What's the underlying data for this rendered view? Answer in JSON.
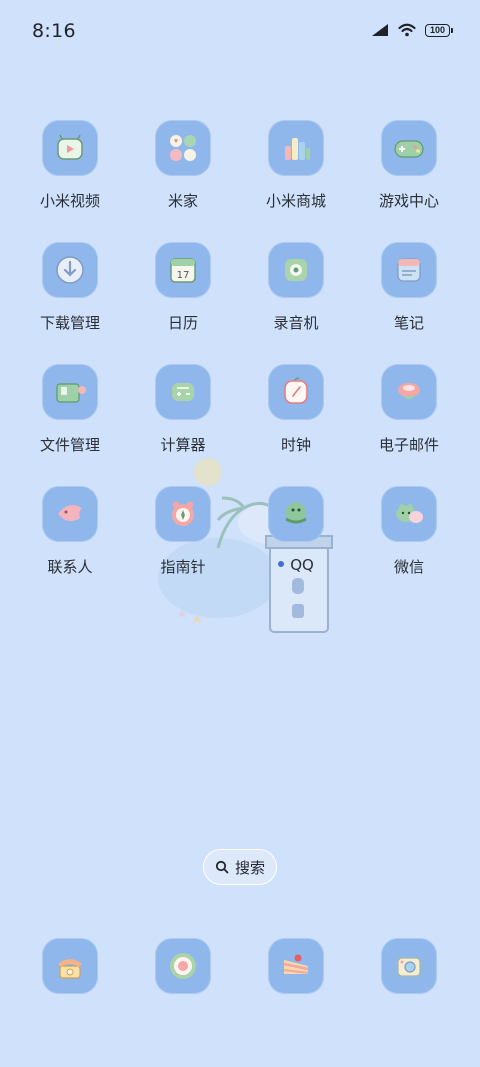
{
  "status_bar": {
    "time": "8:16",
    "battery": "100"
  },
  "apps": [
    {
      "label": "小米视频",
      "icon": "mi-video-icon"
    },
    {
      "label": "米家",
      "icon": "mijia-icon"
    },
    {
      "label": "小米商城",
      "icon": "mi-store-icon"
    },
    {
      "label": "游戏中心",
      "icon": "game-center-icon"
    },
    {
      "label": "下载管理",
      "icon": "download-manager-icon"
    },
    {
      "label": "日历",
      "icon": "calendar-icon",
      "day": "17"
    },
    {
      "label": "录音机",
      "icon": "recorder-icon"
    },
    {
      "label": "笔记",
      "icon": "notes-icon"
    },
    {
      "label": "文件管理",
      "icon": "file-manager-icon"
    },
    {
      "label": "计算器",
      "icon": "calculator-icon"
    },
    {
      "label": "时钟",
      "icon": "clock-icon"
    },
    {
      "label": "电子邮件",
      "icon": "email-icon"
    },
    {
      "label": "联系人",
      "icon": "contacts-icon"
    },
    {
      "label": "指南针",
      "icon": "compass-icon"
    },
    {
      "label": "QQ",
      "icon": "qq-icon",
      "new_dot": true
    },
    {
      "label": "微信",
      "icon": "wechat-icon"
    }
  ],
  "search": {
    "label": "搜索"
  },
  "dock": [
    {
      "icon": "phone-icon"
    },
    {
      "icon": "browser-icon"
    },
    {
      "icon": "gallery-cake-icon"
    },
    {
      "icon": "camera-icon"
    }
  ],
  "colors": {
    "background": "#cfe1fb",
    "icon_tile": "#8fb7ec",
    "accent_green": "#8fc59a",
    "accent_pink": "#f3a7a7"
  }
}
